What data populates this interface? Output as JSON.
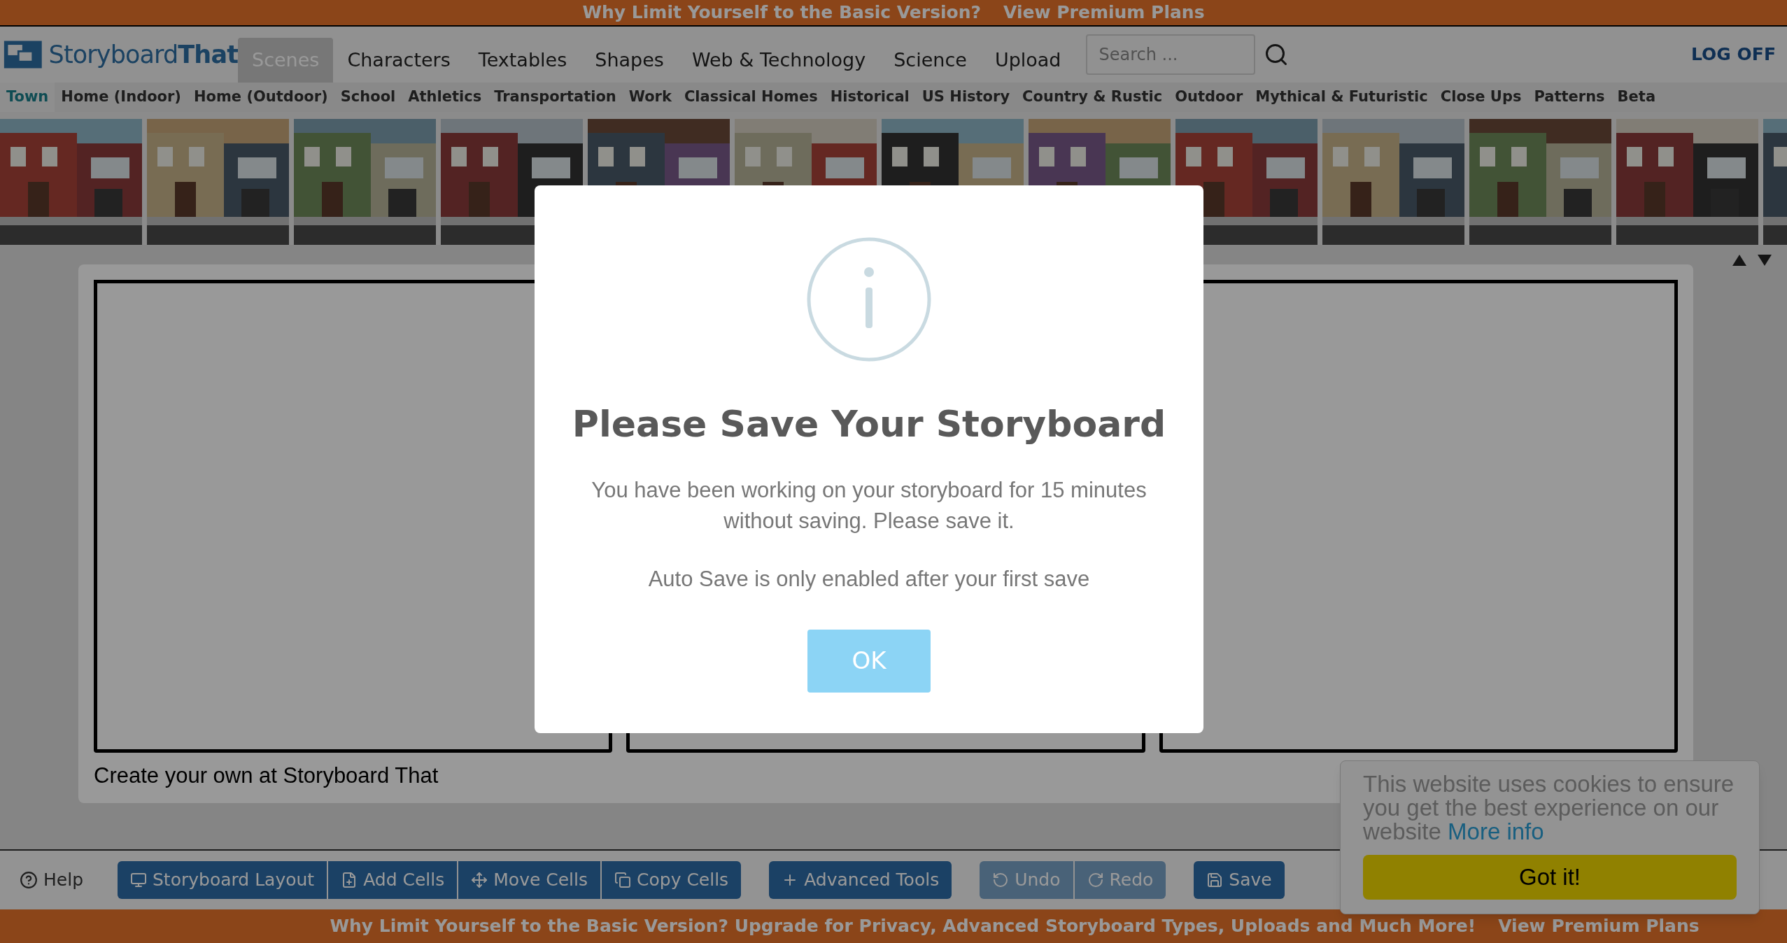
{
  "top_banner": {
    "question": "Why Limit Yourself to the Basic Version?",
    "link": "View Premium Plans"
  },
  "logo": {
    "part_1": "Storyboard",
    "part_2": "That"
  },
  "tabs": [
    {
      "label": "Scenes",
      "selected": true
    },
    {
      "label": "Characters",
      "selected": false
    },
    {
      "label": "Textables",
      "selected": false
    },
    {
      "label": "Shapes",
      "selected": false
    },
    {
      "label": "Web & Technology",
      "selected": false
    },
    {
      "label": "Science",
      "selected": false
    },
    {
      "label": "Upload",
      "selected": false
    }
  ],
  "search": {
    "placeholder": "Search ..."
  },
  "log_off": "LOG OFF",
  "categories": [
    {
      "label": "Town",
      "selected": true
    },
    {
      "label": "Home (Indoor)",
      "selected": false
    },
    {
      "label": "Home (Outdoor)",
      "selected": false
    },
    {
      "label": "School",
      "selected": false
    },
    {
      "label": "Athletics",
      "selected": false
    },
    {
      "label": "Transportation",
      "selected": false
    },
    {
      "label": "Work",
      "selected": false
    },
    {
      "label": "Classical Homes",
      "selected": false
    },
    {
      "label": "Historical",
      "selected": false
    },
    {
      "label": "US History",
      "selected": false
    },
    {
      "label": "Country & Rustic",
      "selected": false
    },
    {
      "label": "Outdoor",
      "selected": false
    },
    {
      "label": "Mythical & Futuristic",
      "selected": false
    },
    {
      "label": "Close Ups",
      "selected": false
    },
    {
      "label": "Patterns",
      "selected": false
    },
    {
      "label": "Beta",
      "selected": false
    }
  ],
  "storyboard": {
    "caption": "Create your own at Storyboard That"
  },
  "toolbar": {
    "help": "Help",
    "groups": [
      [
        {
          "label": "Storyboard Layout",
          "disabled": false
        },
        {
          "label": "Add Cells",
          "disabled": false
        },
        {
          "label": "Move Cells",
          "disabled": false
        },
        {
          "label": "Copy Cells",
          "disabled": false
        }
      ],
      [
        {
          "label": "Advanced Tools",
          "disabled": false
        }
      ],
      [
        {
          "label": "Undo",
          "disabled": true
        },
        {
          "label": "Redo",
          "disabled": true
        }
      ],
      [
        {
          "label": "Save",
          "disabled": false
        }
      ]
    ]
  },
  "bottom_banner": {
    "text": "Why Limit Yourself to the Basic Version? Upgrade for Privacy, Advanced Storyboard Types, Uploads and Much More!",
    "link": "View Premium Plans"
  },
  "modal": {
    "title": "Please Save Your Storyboard",
    "message": "You have been working on your storyboard for 15 minutes without saving. Please save it.",
    "note": "Auto Save is only enabled after your first save",
    "button": "OK"
  },
  "cookie": {
    "message": "This website uses cookies to ensure you get the best experience on our website",
    "link": "More info",
    "button": "Got it!"
  }
}
